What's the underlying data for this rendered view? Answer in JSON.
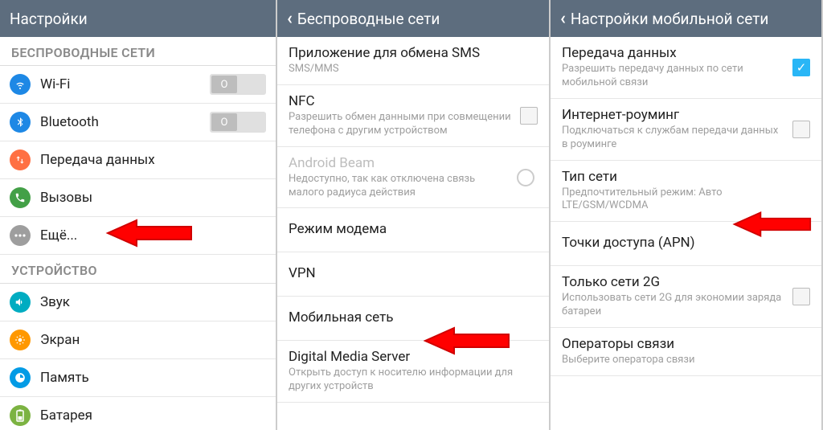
{
  "panel1": {
    "header": "Настройки",
    "section1": "БЕСПРОВОДНЫЕ СЕТИ",
    "wifi": "Wi-Fi",
    "bt": "Bluetooth",
    "data": "Передача данных",
    "calls": "Вызовы",
    "more": "Ещё...",
    "toggle_off": "O",
    "section2": "УСТРОЙСТВО",
    "sound": "Звук",
    "screen": "Экран",
    "memory": "Память",
    "battery": "Батарея"
  },
  "panel2": {
    "header": "Беспроводные сети",
    "sms_title": "Приложение для обмена SMS",
    "sms_sub": "SMS/MMS",
    "nfc_title": "NFC",
    "nfc_sub": "Разрешить обмен данными при совмещении телефона с другим устройством",
    "beam_title": "Android Beam",
    "beam_sub": "Недоступно, так как отключена связь малого радиуса действия",
    "tether": "Режим модема",
    "vpn": "VPN",
    "mobile": "Мобильная сеть",
    "dms_title": "Digital Media Server",
    "dms_sub": "Открыть доступ к носителю информации для других устройств"
  },
  "panel3": {
    "header": "Настройки мобильной сети",
    "data_title": "Передача данных",
    "data_sub": "Разрешить передачу данных по сети мобильной связи",
    "roam_title": "Интернет-роуминг",
    "roam_sub": "Подключаться к службам передачи данных в роуминге",
    "nettype_title": "Тип сети",
    "nettype_sub": "Предпочтительный режим: Авто LTE/GSM/WCDMA",
    "apn": "Точки доступа (APN)",
    "only2g_title": "Только сети 2G",
    "only2g_sub": "Использовать сети 2G для экономии заряда батареи",
    "ops_title": "Операторы связи",
    "ops_sub": "Выберите оператора связи"
  }
}
